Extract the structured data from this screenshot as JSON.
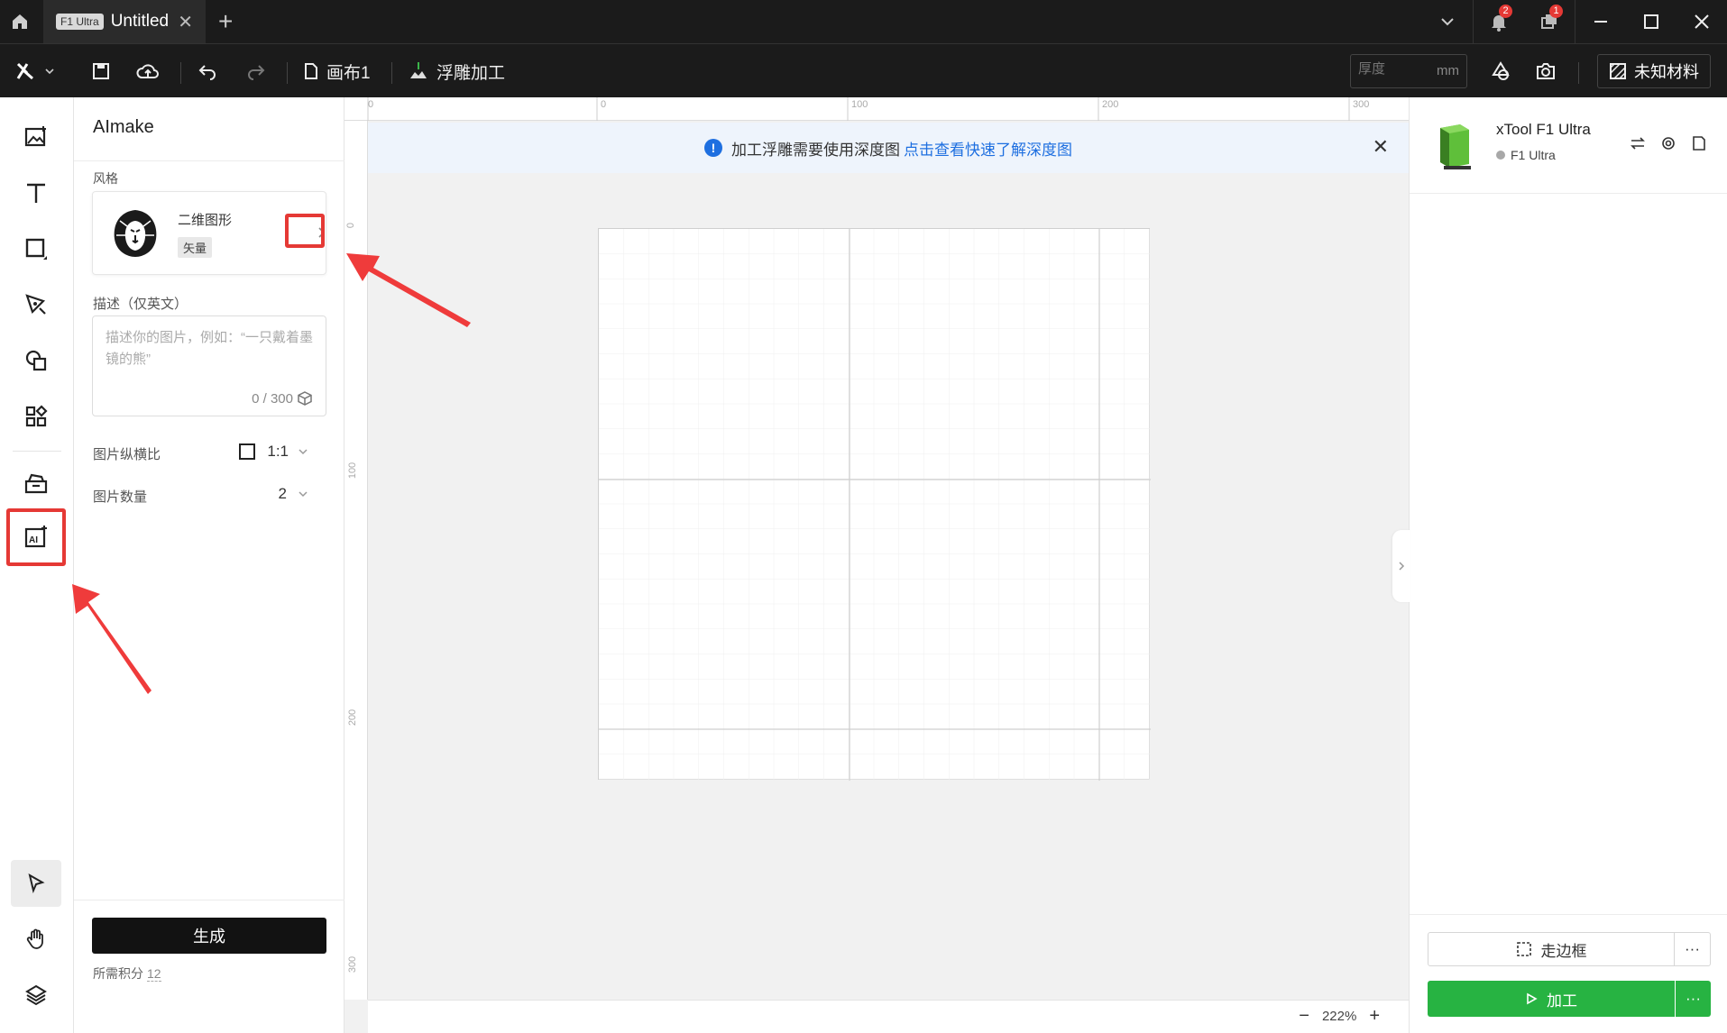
{
  "titlebar": {
    "tab_badge": "F1 Ultra",
    "tab_title": "Untitled",
    "notifications_count": "2",
    "messages_count": "1"
  },
  "toolbar": {
    "canvas_label": "画布1",
    "mode_label": "浮雕加工",
    "thickness_placeholder": "厚度",
    "thickness_unit": "mm",
    "material_label": "未知材料"
  },
  "panel": {
    "title": "AImake",
    "style_label": "风格",
    "style_name": "二维图形",
    "style_tag": "矢量",
    "desc_label": "描述（仅英文）",
    "desc_placeholder": "描述你的图片，例如：“一只戴着墨镜的熊”",
    "desc_count": "0 / 300",
    "ratio_label": "图片纵横比",
    "ratio_value": "1:1",
    "count_label": "图片数量",
    "count_value": "2",
    "generate_label": "生成",
    "credits_label": "所需积分",
    "credits_value": "12"
  },
  "ruler": {
    "top_labels": [
      "0",
      "0",
      "100",
      "200",
      "300"
    ],
    "left_labels": [
      "0",
      "100",
      "200",
      "300"
    ]
  },
  "notice": {
    "text": "加工浮雕需要使用深度图",
    "link": "点击查看快速了解深度图"
  },
  "status": {
    "zoom": "222%"
  },
  "device": {
    "name": "xTool F1 Ultra",
    "model": "F1 Ultra",
    "frame_label": "走边框",
    "run_label": "加工",
    "more_label": "···"
  },
  "colors": {
    "accent_blue": "#1e6fe0",
    "run_green": "#27b342",
    "highlight_red": "#e53935",
    "dark_bar": "#1b1b1b"
  }
}
